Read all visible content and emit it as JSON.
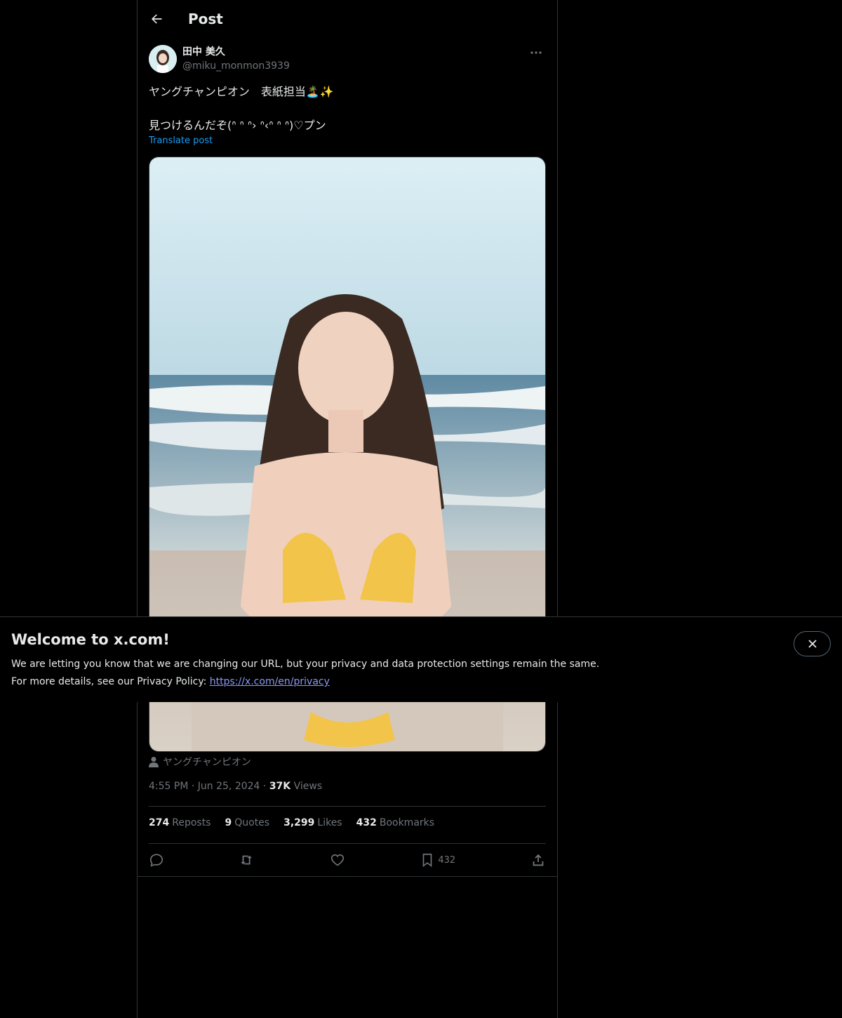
{
  "header": {
    "title": "Post"
  },
  "author": {
    "display_name": "田中 美久",
    "handle": "@miku_monmon3939"
  },
  "post": {
    "line1": "ヤングチャンピオン　表紙担当🏝️✨",
    "line2": "見つけるんだぞ(ᐢ ᐢ ᐢ› ᐢ‹ᐢ ᐢ ᐢ)♡プン",
    "translate_label": "Translate post",
    "media_tag": "ヤングチャンピオン",
    "time": "4:55 PM",
    "date": "Jun 25, 2024",
    "views_count": "37K",
    "views_label": "Views"
  },
  "stats": {
    "reposts_count": "274",
    "reposts_label": "Reposts",
    "quotes_count": "9",
    "quotes_label": "Quotes",
    "likes_count": "3,299",
    "likes_label": "Likes",
    "bookmarks_count": "432",
    "bookmarks_label": "Bookmarks"
  },
  "actions": {
    "bookmark_count": "432"
  },
  "banner": {
    "title": "Welcome to x.com!",
    "line1": "We are letting you know that we are changing our URL, but your privacy and data protection settings remain the same.",
    "line2_prefix": "For more details, see our Privacy Policy: ",
    "link_text": "https://x.com/en/privacy"
  },
  "colors": {
    "accent": "#1d9bf0",
    "background": "#000000",
    "text": "#e7e9ea",
    "muted": "#71767b",
    "border": "#2f3336",
    "link": "#8b98f5"
  }
}
